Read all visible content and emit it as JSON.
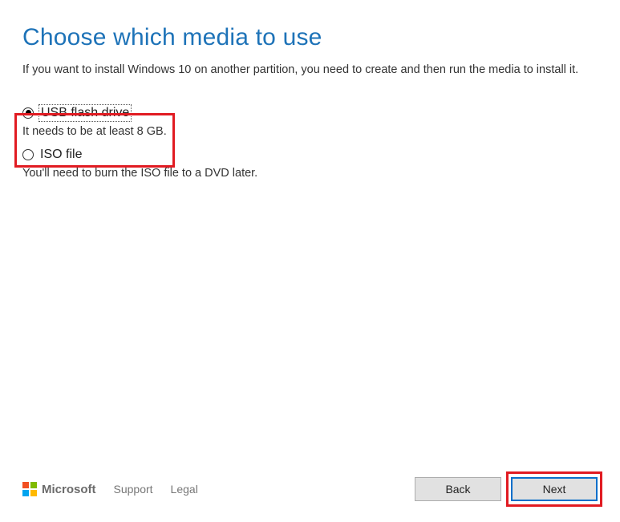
{
  "header": {
    "title": "Choose which media to use",
    "subtitle": "If you want to install Windows 10 on another partition, you need to create and then run the media to install it."
  },
  "options": [
    {
      "label": "USB flash drive",
      "description": "It needs to be at least 8 GB.",
      "selected": true
    },
    {
      "label": "ISO file",
      "description": "You'll need to burn the ISO file to a DVD later.",
      "selected": false
    }
  ],
  "footer": {
    "brand": "Microsoft",
    "links": {
      "support": "Support",
      "legal": "Legal"
    },
    "buttons": {
      "back": "Back",
      "next": "Next"
    }
  }
}
